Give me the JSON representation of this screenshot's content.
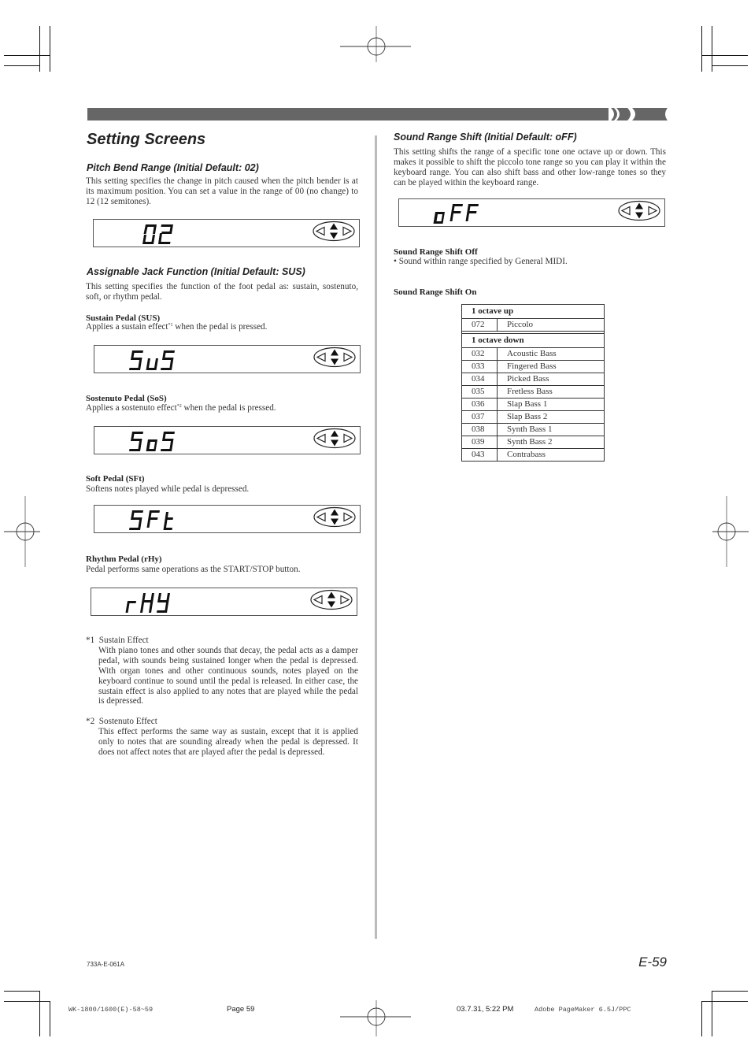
{
  "header": {
    "title": "Setting Screens",
    "bar_color": "#666666"
  },
  "pitch_bend": {
    "heading": "Pitch Bend Range (Initial Default: 02)",
    "body": "This setting specifies the change in pitch caused when the pitch bender is at its maximum position. You can set a value in the range of 00 (no change) to 12 (12 semitones).",
    "display": "02"
  },
  "jack_function": {
    "heading": "Assignable Jack Function (Initial Default: SUS)",
    "body": "This setting specifies the function of the foot pedal as: sustain, sostenuto, soft, or rhythm pedal.",
    "items": [
      {
        "title": "Sustain Pedal (SUS)",
        "desc_before": "Applies a sustain effect",
        "note": "*1",
        "desc_after": " when the pedal is pressed.",
        "display": "SUS"
      },
      {
        "title": "Sostenuto Pedal (SoS)",
        "desc_before": "Applies a sostenuto effect",
        "note": "*2",
        "desc_after": " when the pedal is pressed.",
        "display": "SoS"
      },
      {
        "title": "Soft Pedal (SFt)",
        "desc_before": "Softens notes played while pedal is depressed.",
        "note": "",
        "desc_after": "",
        "display": "SFt"
      },
      {
        "title": "Rhythm Pedal (rHy)",
        "desc_before": "Pedal performs same operations as the START/STOP button.",
        "note": "",
        "desc_after": "",
        "display": "rHy"
      }
    ]
  },
  "footnotes": [
    {
      "mark": "*1",
      "title": "Sustain Effect",
      "text": "With piano tones and other sounds that decay, the pedal acts as a damper pedal, with sounds being sustained longer when the pedal is depressed. With organ tones and other continuous sounds, notes played on the keyboard continue to sound until the pedal is released. In either case, the sustain effect is also applied to any notes that are played while the pedal is depressed."
    },
    {
      "mark": "*2",
      "title": "Sostenuto Effect",
      "text": "This effect performs the same way as sustain, except that it is applied only to notes that are sounding already when the pedal is depressed. It does not affect notes that are played after the pedal is depressed."
    }
  ],
  "sound_range": {
    "heading": "Sound Range Shift (Initial Default: oFF)",
    "body": "This setting shifts the range of a specific tone one octave up or down. This makes it possible to shift the piccolo tone range so you can play it within the keyboard range. You can also shift bass and other low-range tones so they can be played within the keyboard range.",
    "display": "oFF",
    "off_title": "Sound Range Shift Off",
    "off_bullet": "• Sound within range specified by General MIDI.",
    "on_title": "Sound Range Shift On",
    "table": {
      "groups": [
        {
          "label": "1 octave up",
          "rows": [
            [
              "072",
              "Piccolo"
            ]
          ]
        },
        {
          "label": "1 octave down",
          "rows": [
            [
              "032",
              "Acoustic Bass"
            ],
            [
              "033",
              "Fingered Bass"
            ],
            [
              "034",
              "Picked Bass"
            ],
            [
              "035",
              "Fretless Bass"
            ],
            [
              "036",
              "Slap Bass 1"
            ],
            [
              "037",
              "Slap Bass 2"
            ],
            [
              "038",
              "Synth Bass 1"
            ],
            [
              "039",
              "Synth Bass 2"
            ],
            [
              "043",
              "Contrabass"
            ]
          ]
        }
      ]
    }
  },
  "footer": {
    "doc_code": "733A-E-061A",
    "page_number": "E-59",
    "slug_file": "WK-1800/1600(E)-58~59",
    "slug_page": "Page 59",
    "slug_date": "03.7.31, 5:22 PM",
    "slug_app": "Adobe PageMaker 6.5J/PPC"
  },
  "icons": {
    "lcd_cursor": "cursor-arrows-icon",
    "registration": "registration-mark-icon"
  }
}
